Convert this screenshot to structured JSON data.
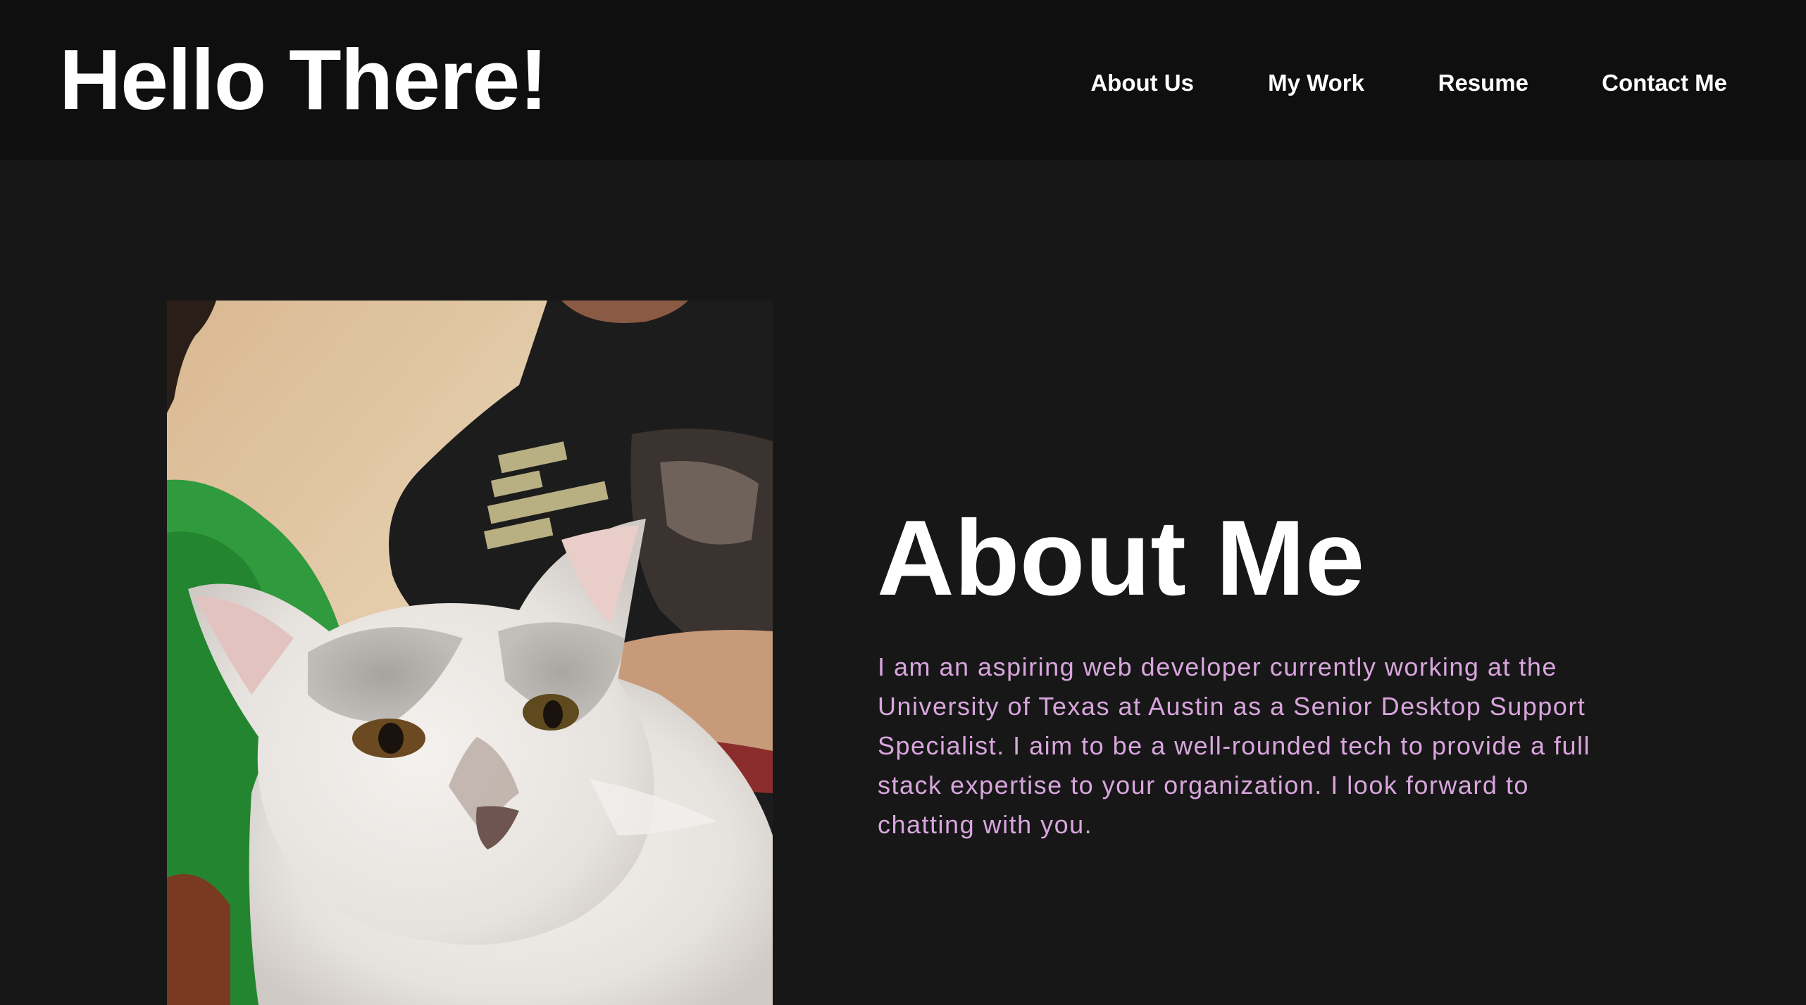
{
  "header": {
    "title": "Hello There!",
    "nav": [
      {
        "label": "About Us"
      },
      {
        "label": "My Work"
      },
      {
        "label": "Resume"
      },
      {
        "label": "Contact Me"
      }
    ]
  },
  "about": {
    "heading": "About Me",
    "body": "I am an aspiring web developer currently working at the University of Texas at Austin as a Senior Desktop Support Specialist. I aim to be a well-rounded tech to provide a full stack expertise to your organization. I look forward to chatting with you.",
    "image_description_icon": "profile-photo-with-cat"
  },
  "colors": {
    "header_bg": "#0f0f0f",
    "page_bg": "#171717",
    "title": "#ffffff",
    "body_text": "#d8a6dd"
  }
}
